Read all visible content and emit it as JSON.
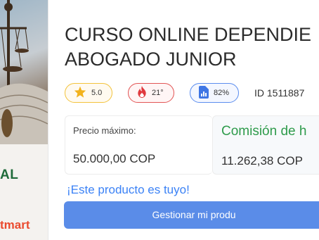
{
  "product": {
    "title_line1": "CURSO ONLINE DEPENDIE",
    "title_line2": "ABOGADO JUNIOR",
    "image": {
      "text_partial": "AL",
      "brand_partial": "tmart"
    }
  },
  "badges": {
    "rating": {
      "value": "5.0",
      "icon": "star-icon",
      "color": "#f3c33c"
    },
    "temperature": {
      "value": "21°",
      "icon": "flame-icon",
      "color": "#e25555"
    },
    "score": {
      "value": "82%",
      "icon": "chart-document-icon",
      "color": "#5b8def"
    }
  },
  "product_id": "ID 1511887",
  "pricing": {
    "max_price_label": "Precio máximo:",
    "max_price_value": "50.000,00 COP",
    "commission_label": "Comisión de h",
    "commission_value": "11.262,38 COP"
  },
  "status": {
    "owned_text": "¡Este producto es tuyo!"
  },
  "actions": {
    "manage_label": "Gestionar mi produ"
  },
  "colors": {
    "accent_blue": "#5a8ce8",
    "link_blue": "#3b82f6",
    "commission_green": "#2e9b4b",
    "brand_orange": "#ea4b2f"
  }
}
